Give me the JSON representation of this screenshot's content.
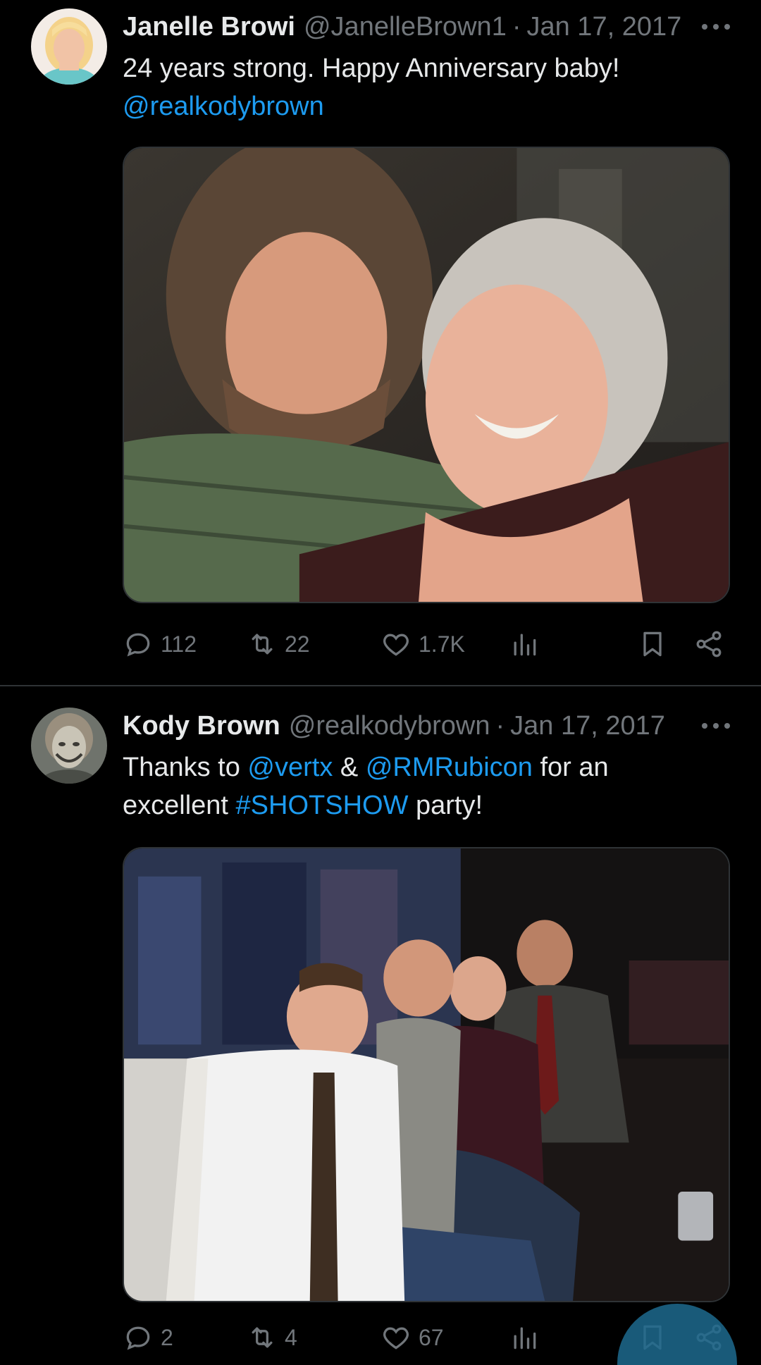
{
  "tweets": [
    {
      "author_name": "Janelle Browi",
      "handle": "@JanelleBrown1",
      "separator": "·",
      "date": "Jan 17, 2017",
      "text_parts": {
        "line1": "24 years strong.  Happy Anniversary baby!",
        "mention": "@realkodybrown"
      },
      "stats": {
        "replies": "112",
        "retweets": "22",
        "likes": "1.7K"
      },
      "media_description_icon": "photo-selfie-couple"
    },
    {
      "author_name": "Kody Brown",
      "handle": "@realkodybrown",
      "separator": "·",
      "date": "Jan 17, 2017",
      "text_parts": {
        "t1": "Thanks to ",
        "mention1": "@vertx",
        "t2": " & ",
        "mention2": "@RMRubicon",
        "t3": " for an",
        "t4": "excellent ",
        "hashtag": "#SHOTSHOW",
        "t5": " party!"
      },
      "stats": {
        "replies": "2",
        "retweets": "4",
        "likes": "67"
      },
      "media_description_icon": "photo-group-party"
    }
  ],
  "colors": {
    "background": "#000000",
    "text": "#e7e9ea",
    "muted": "#71767b",
    "link": "#1d9bf0",
    "divider": "#2f3336"
  },
  "icons": [
    "more-icon",
    "reply-icon",
    "retweet-icon",
    "like-icon",
    "views-icon",
    "bookmark-icon",
    "share-icon"
  ]
}
